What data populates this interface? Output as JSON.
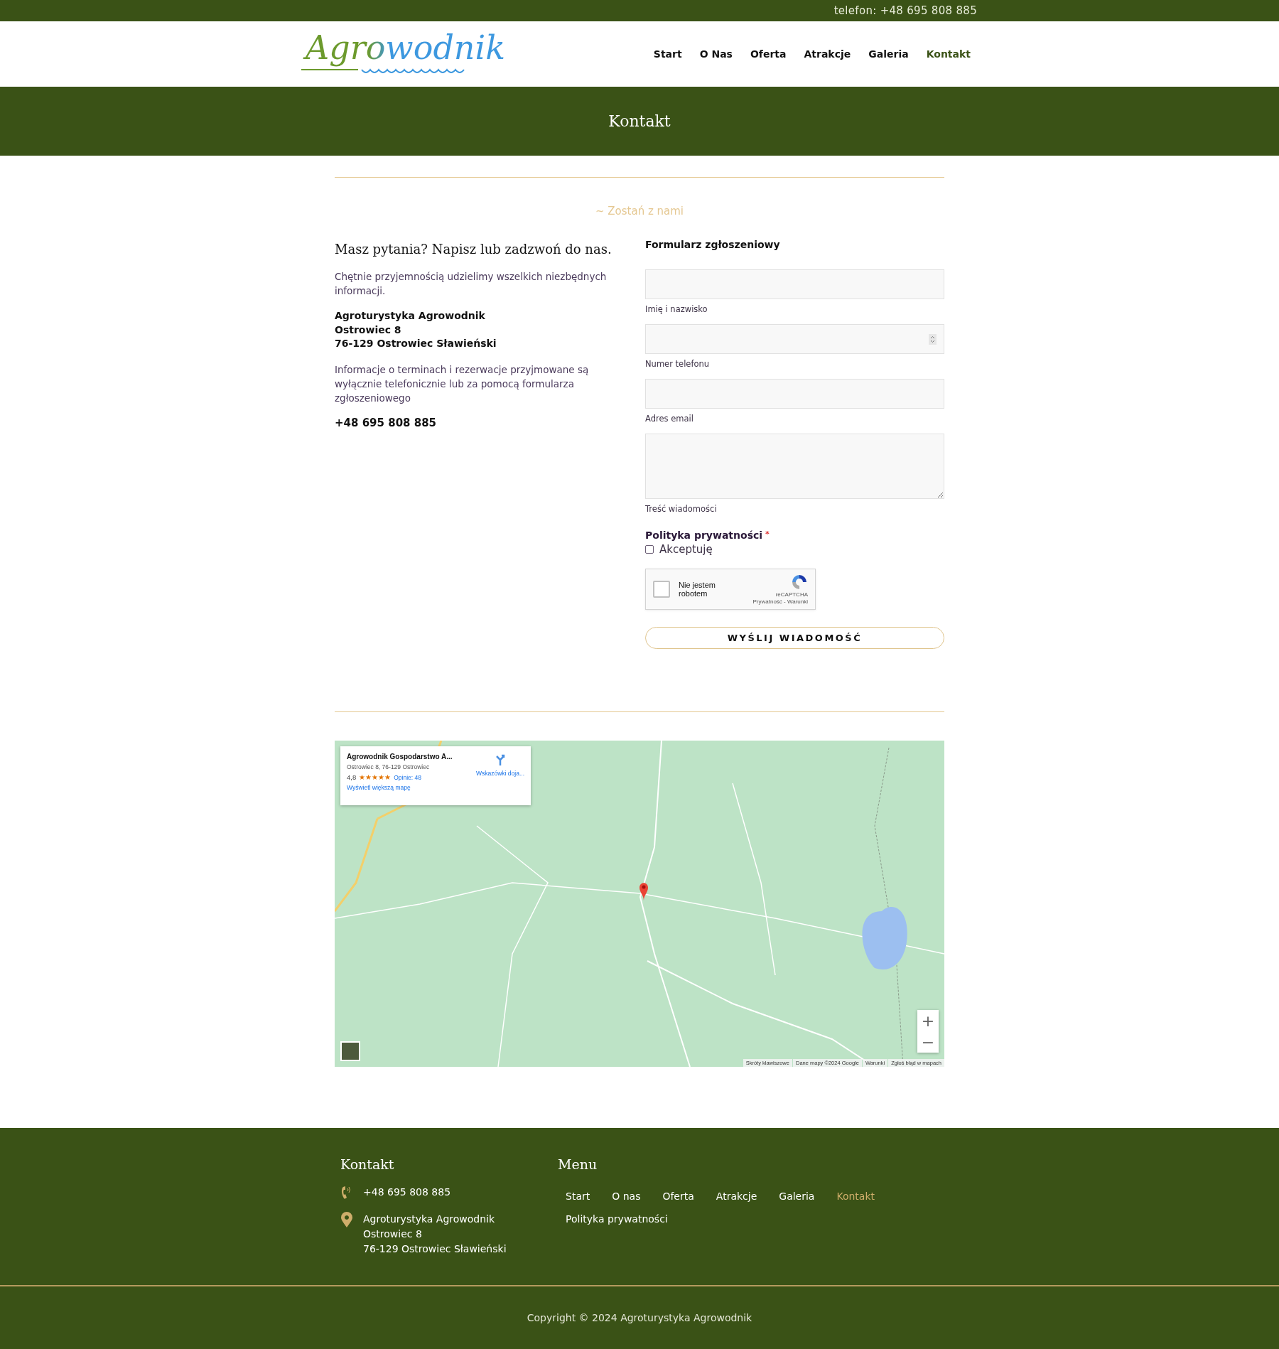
{
  "top_bar": {
    "phone": "telefon: +48 695 808 885"
  },
  "header": {
    "logo": "Agrowodnik",
    "nav": [
      {
        "label": "Start",
        "selected": false
      },
      {
        "label": "O Nas",
        "selected": false
      },
      {
        "label": "Oferta",
        "selected": false
      },
      {
        "label": "Atrakcje",
        "selected": false
      },
      {
        "label": "Galeria",
        "selected": false
      },
      {
        "label": "Kontakt",
        "selected": true
      }
    ]
  },
  "page_title": "Kontakt",
  "tagline": "~ Zostań z nami",
  "contact": {
    "heading": "Masz pytania? Napisz lub zadzwoń do nas.",
    "intro": "Chętnie przyjemnością udzielimy wszelkich niezbędnych informacji.",
    "address": [
      "Agroturystyka Agrowodnik",
      "Ostrowiec 8",
      "76-129 Ostrowiec Sławieński"
    ],
    "note": "Informacje o terminach i rezerwacje przyjmowane są wyłącznie telefonicznie lub za pomocą formularza zgłoszeniowego",
    "phone": "+48 695 808 885"
  },
  "form": {
    "title": "Formularz zgłoszeniowy",
    "fields": [
      {
        "kind": "text",
        "label": "Imię i nazwisko"
      },
      {
        "kind": "number",
        "label": "Numer telefonu"
      },
      {
        "kind": "email",
        "label": "Adres email"
      },
      {
        "kind": "textarea",
        "label": "Treść wiadomości"
      }
    ],
    "privacy": {
      "label": "Polityka prywatności",
      "required_mark": "*",
      "option": "Akceptuję",
      "checked": false
    },
    "captcha": {
      "label": "Nie jestem robotem",
      "checked": false,
      "brand": "reCAPTCHA",
      "links": "Prywatność - Warunki"
    },
    "submit": "WYŚLIJ WIADOMOŚĆ"
  },
  "map": {
    "card": {
      "title": "Agrowodnik Gospodarstwo A...",
      "address": "Ostrowiec 8, 76-129 Ostrowiec",
      "rating": "4,8",
      "stars": 5,
      "reviews": "Opinie: 48",
      "larger_map": "Wyświetl większą mapę",
      "directions": "Wskazówki doja..."
    },
    "zoom_in": "+",
    "zoom_out": "−",
    "attribution": [
      "Skróty klawiszowe",
      "Dane mapy ©2024 Google",
      "Warunki",
      "Zgłoś błąd w mapach"
    ]
  },
  "footer": {
    "contact_title": "Kontakt",
    "phone": "+48 695 808 885",
    "address": [
      "Agroturystyka Agrowodnik",
      "Ostrowiec 8",
      "76-129 Ostrowiec Sławieński"
    ],
    "menu_title": "Menu",
    "menu": [
      {
        "label": "Start",
        "selected": false
      },
      {
        "label": "O nas",
        "selected": false
      },
      {
        "label": "Oferta",
        "selected": false
      },
      {
        "label": "Atrakcje",
        "selected": false
      },
      {
        "label": "Galeria",
        "selected": false
      },
      {
        "label": "Kontakt",
        "selected": true
      },
      {
        "label": "Polityka prywatności",
        "selected": false
      }
    ],
    "copyright": "Copyright © 2024 Agroturystyka Agrowodnik"
  }
}
